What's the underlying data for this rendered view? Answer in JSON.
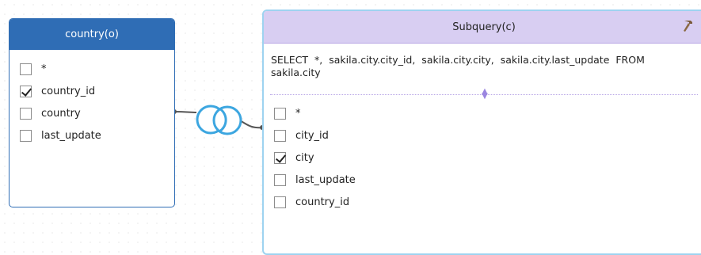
{
  "left_table": {
    "title": "country(o)",
    "fields": [
      {
        "label": "*",
        "checked": false
      },
      {
        "label": "country_id",
        "checked": true
      },
      {
        "label": "country",
        "checked": false
      },
      {
        "label": "last_update",
        "checked": false
      }
    ]
  },
  "subquery": {
    "title": "Subquery(c)",
    "sql": "SELECT *, sakila.city.city_id, sakila.city.city, sakila.city.last_update FROM sakila.city",
    "fields": [
      {
        "label": "*",
        "checked": false
      },
      {
        "label": "city_id",
        "checked": false
      },
      {
        "label": "city",
        "checked": true
      },
      {
        "label": "last_update",
        "checked": false
      },
      {
        "label": "country_id",
        "checked": false
      }
    ]
  },
  "join": {
    "icon": "inner-join-icon",
    "color": "#3ca6e0"
  },
  "colors": {
    "left_header": "#2f6db5",
    "subquery_header": "#d8cef2",
    "subquery_border": "#9ed3f0"
  }
}
